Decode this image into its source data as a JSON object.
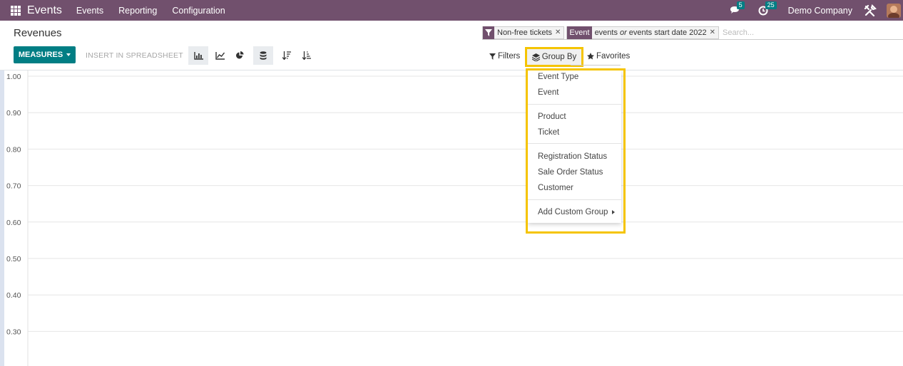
{
  "navbar": {
    "app_name": "Events",
    "menus": [
      "Events",
      "Reporting",
      "Configuration"
    ],
    "messages_count": "5",
    "activities_count": "25",
    "company": "Demo Company"
  },
  "breadcrumb": "Revenues",
  "toolbar": {
    "measures_label": "MEASURES",
    "spreadsheet_label": "INSERT IN SPREADSHEET"
  },
  "search": {
    "facets": [
      {
        "label": "",
        "icon": "filter-icon",
        "value": "Non-free tickets"
      },
      {
        "label": "Event",
        "value_a": "events",
        "connector": "or",
        "value_b": "events start date 2022"
      }
    ],
    "placeholder": "Search..."
  },
  "search_panel": {
    "filters_label": "Filters",
    "groupby_label": "Group By",
    "favorites_label": "Favorites"
  },
  "groupby_menu": {
    "items": [
      "Event Type",
      "Event",
      "Product",
      "Ticket",
      "Registration Status",
      "Sale Order Status",
      "Customer"
    ],
    "custom_label": "Add Custom Group"
  },
  "chart_data": {
    "type": "bar",
    "categories": [],
    "values": [],
    "ylim": [
      0.3,
      1.0
    ],
    "yticks": [
      "1.00",
      "0.90",
      "0.80",
      "0.70",
      "0.60",
      "0.50",
      "0.40",
      "0.30"
    ],
    "grid": true
  },
  "colors": {
    "brand": "#71506d",
    "accent": "#017e84",
    "highlight": "#f5c400"
  }
}
